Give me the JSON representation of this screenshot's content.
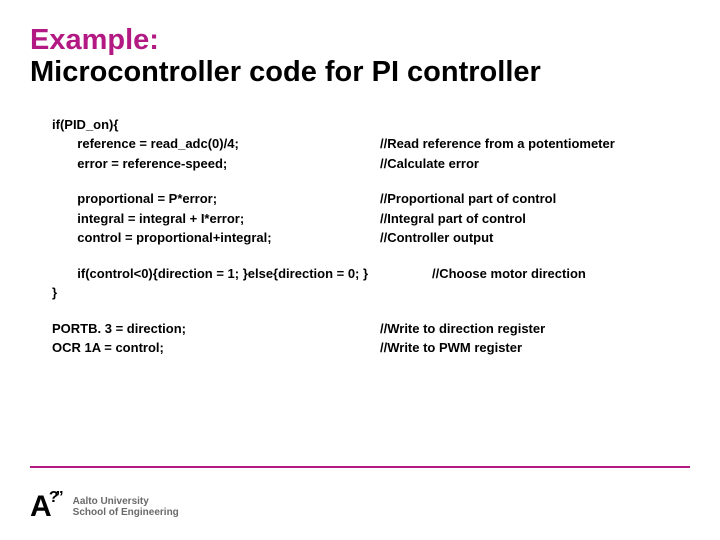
{
  "title": {
    "line1": "Example:",
    "line2": "Microcontroller code for PI controller"
  },
  "code": {
    "r0_left": "if(PID_on){",
    "r1_left": "       reference = read_adc(0)/4;",
    "r1_right": "//Read reference from a potentiometer",
    "r2_left": "       error = reference-speed;",
    "r2_right": "//Calculate error",
    "r3_left": "       proportional = P*error;",
    "r3_right": "//Proportional part of control",
    "r4_left": "       integral = integral + I*error;",
    "r4_right": "//Integral part of control",
    "r5_left": "       control = proportional+integral;",
    "r5_right": "//Controller output",
    "r6_left": "       if(control<0){direction = 1; }else{direction = 0; }",
    "r6_right": "//Choose motor direction",
    "r7_left": "}",
    "r8_left": "PORTB. 3 = direction;",
    "r8_right": "//Write to direction register",
    "r9_left": "OCR 1A = control;",
    "r9_right": "//Write to PWM register"
  },
  "logo": {
    "letter": "A",
    "marks": "?”",
    "line1": "Aalto University",
    "line2": "School of Engineering"
  }
}
